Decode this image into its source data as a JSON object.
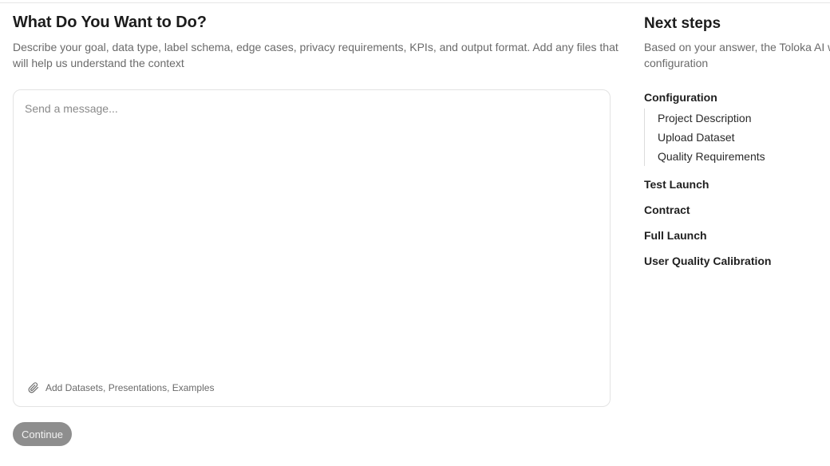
{
  "main": {
    "title": "What Do You Want to Do?",
    "description": "Describe your goal, data type, label schema, edge cases, privacy requirements, KPIs, and output format. Add any files that will help us understand the context",
    "message": {
      "value": "",
      "placeholder": "Send a message..."
    },
    "attach_label": "Add Datasets, Presentations, Examples",
    "continue_label": "Continue"
  },
  "side": {
    "title": "Next steps",
    "description": "Based on your answer, the Toloka AI will help you with configuration",
    "steps": [
      {
        "label": "Configuration",
        "substeps": [
          "Project Description",
          "Upload Dataset",
          "Quality Requirements"
        ]
      },
      {
        "label": "Test Launch"
      },
      {
        "label": "Contract"
      },
      {
        "label": "Full Launch"
      },
      {
        "label": "User Quality Calibration"
      }
    ]
  },
  "colors": {
    "button_disabled": "#8e8e8e",
    "muted_text": "#6a6a6a",
    "border": "#e3e3e3"
  },
  "icons": {
    "attach": "paperclip-icon"
  }
}
